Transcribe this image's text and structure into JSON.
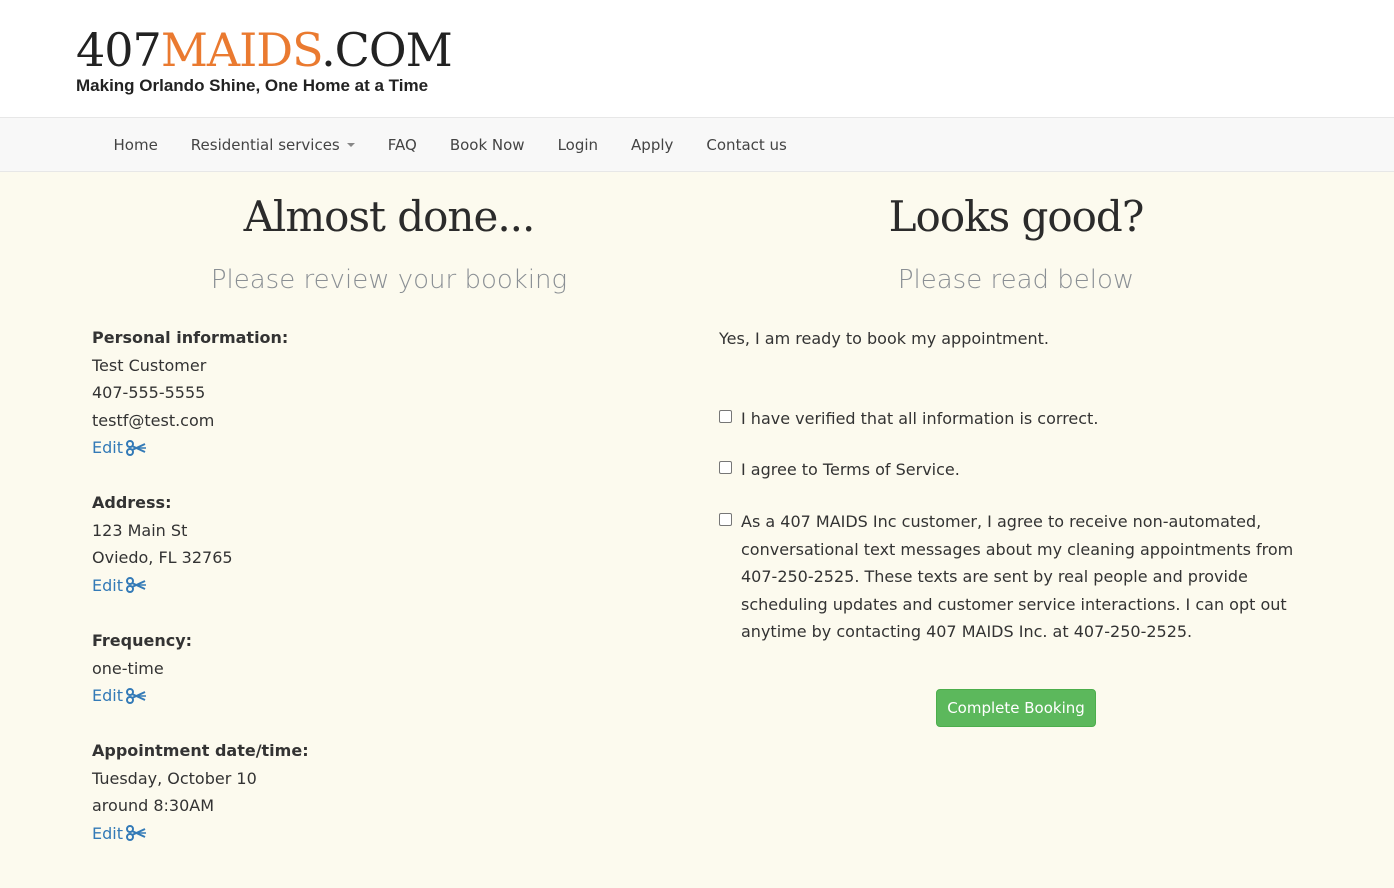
{
  "header": {
    "logo": {
      "part1": "407",
      "part2": "MAIDS",
      "part3": ".COM"
    },
    "tagline": "Making Orlando Shine, One Home at a Time"
  },
  "nav": {
    "items": [
      "Home",
      "Residential services",
      "FAQ",
      "Book Now",
      "Login",
      "Apply",
      "Contact us"
    ]
  },
  "left": {
    "heading": "Almost done...",
    "subheading": "Please review your booking",
    "edit_label": "Edit",
    "personal": {
      "label": "Personal information:",
      "name": "Test Customer",
      "phone": "407-555-5555",
      "email": "testf@test.com"
    },
    "address": {
      "label": "Address:",
      "line1": "123 Main St",
      "line2": "Oviedo, FL 32765"
    },
    "frequency": {
      "label": "Frequency:",
      "value": "one-time"
    },
    "appointment": {
      "label": "Appointment date/time:",
      "date": "Tuesday, October 10",
      "time": "around 8:30AM"
    }
  },
  "right": {
    "heading": "Looks good?",
    "subheading": "Please read below",
    "ready_text": "Yes, I am ready to book my appointment.",
    "checks": [
      {
        "text": "I have verified that all information is correct.",
        "checked": false
      },
      {
        "text": "I agree to Terms of Service.",
        "checked": false
      },
      {
        "text": "As a 407 MAIDS Inc customer, I agree to receive non-automated, conversational text messages about my cleaning appointments from 407-250-2525. These texts are sent by real people and provide scheduling updates and customer service interactions. I can opt out anytime by contacting 407 MAIDS Inc. at 407-250-2525.",
        "checked": false
      }
    ],
    "button_label": "Complete Booking"
  },
  "colors": {
    "accent": "#ea7a30",
    "link": "#337ab7",
    "button": "#5cb85c",
    "page_bg": "#fcfaee"
  }
}
